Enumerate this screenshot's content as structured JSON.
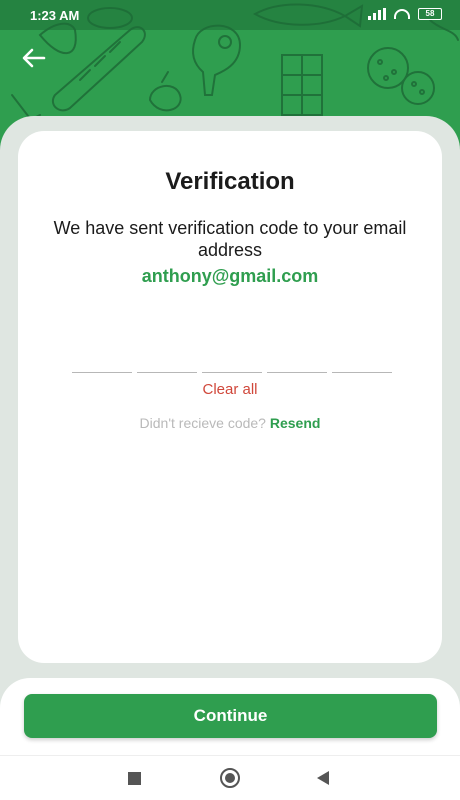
{
  "status_bar": {
    "time": "1:23 AM",
    "battery": "58"
  },
  "header": {
    "back_icon": "arrow-left-icon",
    "background_color": "#2f9e4f"
  },
  "verification": {
    "title": "Verification",
    "message": "We have sent verification code to your email address",
    "email": "anthony@gmail.com",
    "code_digits": [
      "",
      "",
      "",
      "",
      ""
    ],
    "clear_label": "Clear all",
    "resend_question": "Didn't recieve code?",
    "resend_label": "Resend"
  },
  "footer": {
    "continue_label": "Continue"
  },
  "colors": {
    "accent": "#2f9e4f",
    "danger": "#d0473a",
    "muted_text": "#b9b9b9"
  }
}
